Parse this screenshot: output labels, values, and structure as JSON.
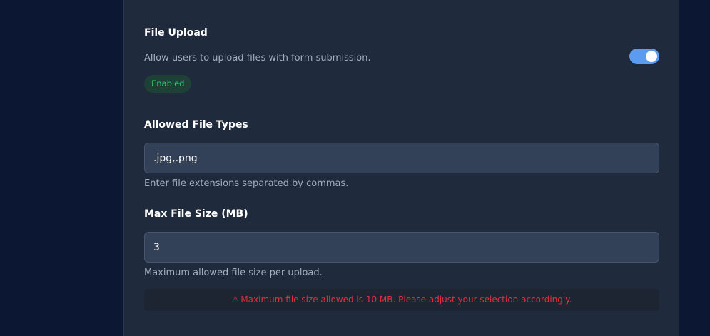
{
  "file_upload": {
    "title": "File Upload",
    "description": "Allow users to upload files with form submission.",
    "toggle_on": true,
    "status_badge": "Enabled"
  },
  "allowed_types": {
    "label": "Allowed File Types",
    "value": ".jpg,.png",
    "help": "Enter file extensions separated by commas."
  },
  "max_size": {
    "label": "Max File Size (MB)",
    "value": "3",
    "help": "Maximum allowed file size per upload."
  },
  "error": {
    "icon": "warning-icon",
    "glyph": "⚠",
    "message": "Maximum file size allowed is 10 MB. Please adjust your selection accordingly."
  },
  "colors": {
    "background": "#0b1733",
    "panel": "#1f2a3d",
    "toggle_on": "#5b9cf0",
    "badge_text": "#34c46f",
    "error_text": "#e0313f"
  }
}
